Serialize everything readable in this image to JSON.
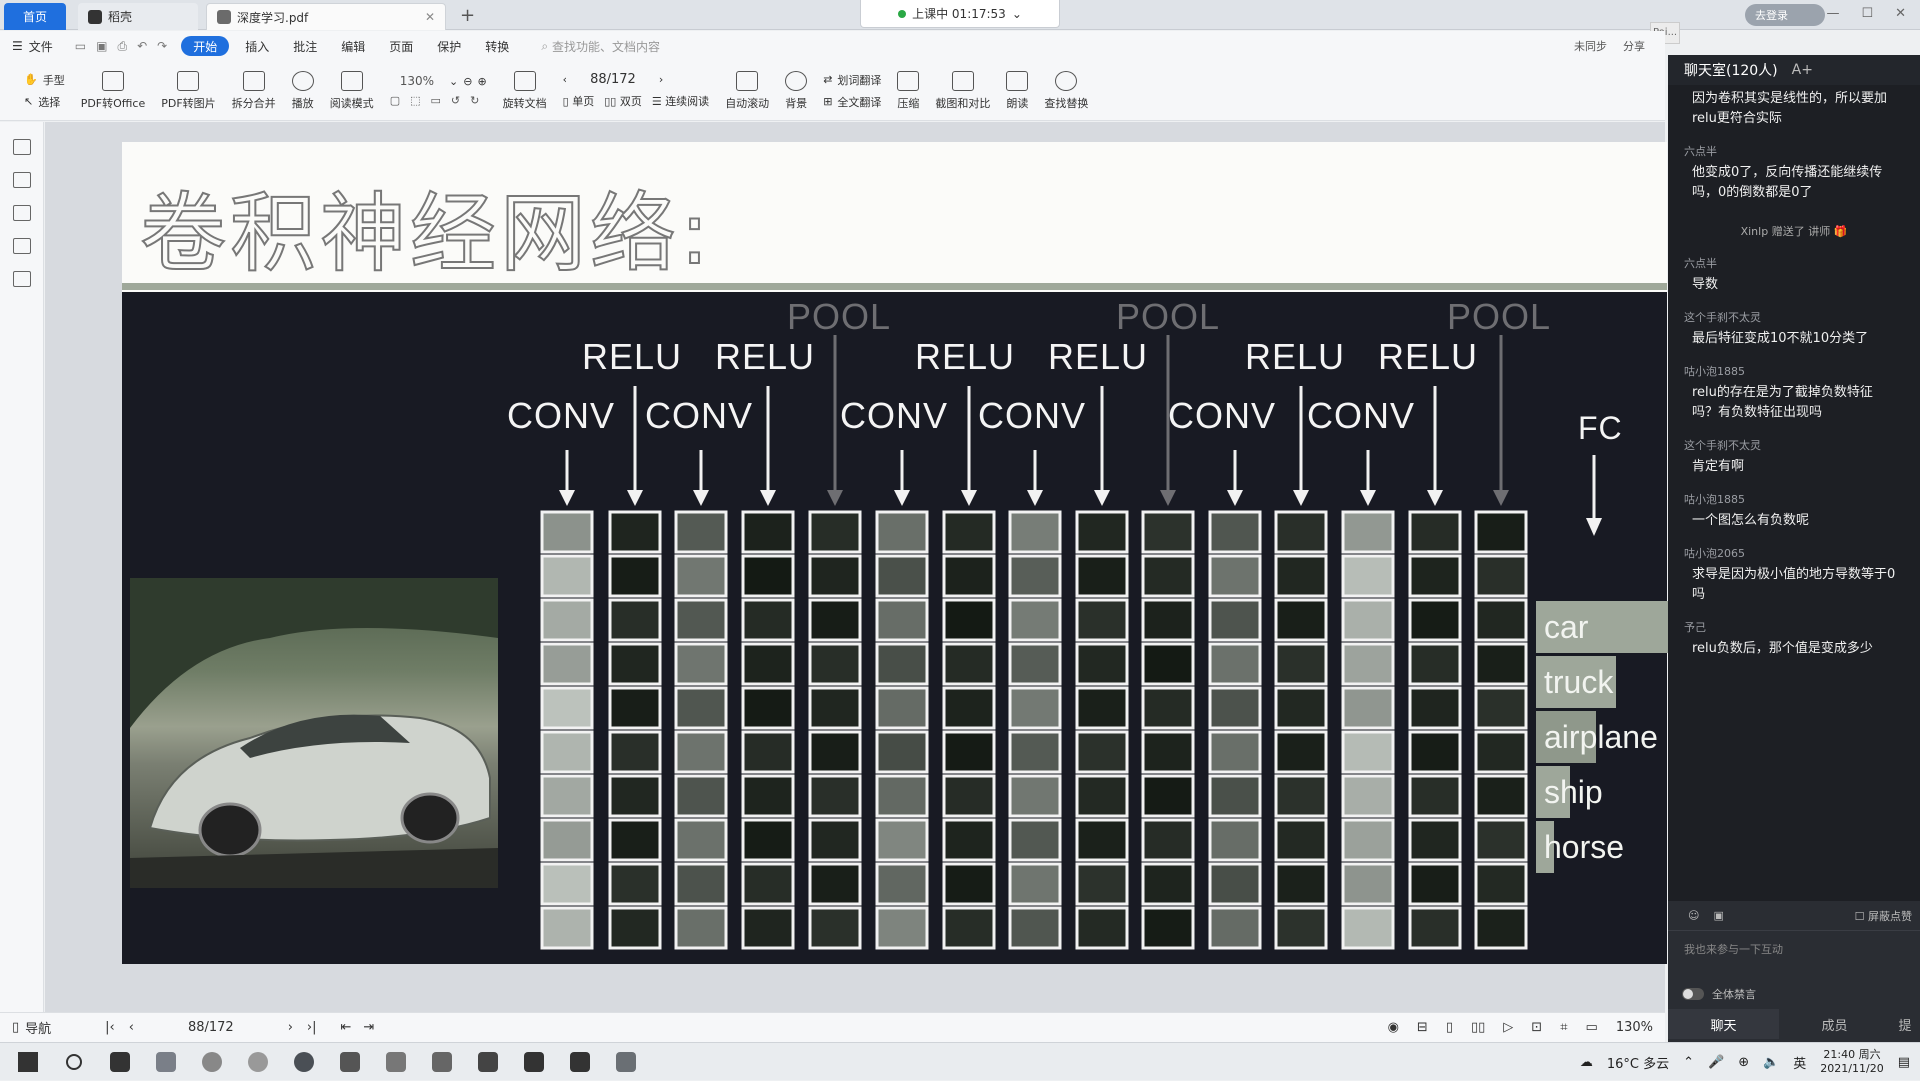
{
  "tabs": [
    {
      "label": "首页"
    },
    {
      "label": "稻壳"
    },
    {
      "label": "深度学习.pdf"
    }
  ],
  "class_status": "上课中 01:17:53",
  "login_label": "去登录",
  "menu": [
    "文件",
    "开始",
    "插入",
    "批注",
    "编辑",
    "页面",
    "保护",
    "转换"
  ],
  "menu_search": "查找功能、文档内容",
  "top_right": {
    "sync": "未同步",
    "share": "分享"
  },
  "peek_label": "Poi...",
  "toolbar": {
    "hand": "手型",
    "select": "选择",
    "pdf_to_office": "PDF转Office",
    "pdf_to_image": "PDF转图片",
    "split_merge": "拆分合并",
    "play": "播放",
    "read_mode": "阅读模式",
    "zoom": "130%",
    "rotate": "旋转文档",
    "page": "88/172",
    "single": "单页",
    "double": "双页",
    "continuous": "连续阅读",
    "auto_scroll": "自动滚动",
    "background": "背景",
    "word_translate": "划词翻译",
    "full_translate": "全文翻译",
    "compress": "压缩",
    "screenshot_compare": "截图和对比",
    "read_aloud": "朗读",
    "find_replace": "查找替换"
  },
  "slide": {
    "title": "卷积神经网络:",
    "stage_labels": {
      "conv": "CONV",
      "relu": "RELU",
      "pool": "POOL",
      "fc": "FC"
    },
    "classes": [
      "car",
      "truck",
      "airplane",
      "ship",
      "horse"
    ]
  },
  "statusbar": {
    "nav": "导航",
    "page": "88/172",
    "zoom": "130%"
  },
  "chat": {
    "title": "聊天室(120人)",
    "font_toggle": "A+",
    "messages": [
      {
        "name": "",
        "text": "因为卷积其实是线性的，所以要加relu更符合实际"
      },
      {
        "name": "六点半",
        "text": "他变成0了，反向传播还能继续传吗，0的倒数都是0了"
      },
      {
        "name": "六点半",
        "text": "导数"
      },
      {
        "name": "这个手刹不太灵",
        "text": "最后特征变成10不就10分类了"
      },
      {
        "name": "咕小泡1885",
        "text": "relu的存在是为了截掉负数特征吗？有负数特征出现吗"
      },
      {
        "name": "这个手刹不太灵",
        "text": "肯定有啊"
      },
      {
        "name": "咕小泡1885",
        "text": "一个图怎么有负数呢"
      },
      {
        "name": "咕小泡2065",
        "text": "求导是因为极小值的地方导数等于0吗"
      },
      {
        "name": "予己",
        "text": "relu负数后，那个值是变成多少"
      }
    ],
    "system_message": "Xinlp 赠送了 讲师",
    "hide_gifts": "屏蔽点赞",
    "input_placeholder": "我也来参与一下互动",
    "mute_all": "全体禁言",
    "tab_chat": "聊天",
    "tab_members": "成员",
    "tab_more": "提"
  },
  "taskbar": {
    "weather": "16°C 多云",
    "ime": "英",
    "time": "21:40 周六",
    "date": "2021/11/20"
  },
  "colors": {
    "accent": "#1f6fde",
    "slide_bg": "#181a23",
    "class_bar": "#9ea79a"
  }
}
